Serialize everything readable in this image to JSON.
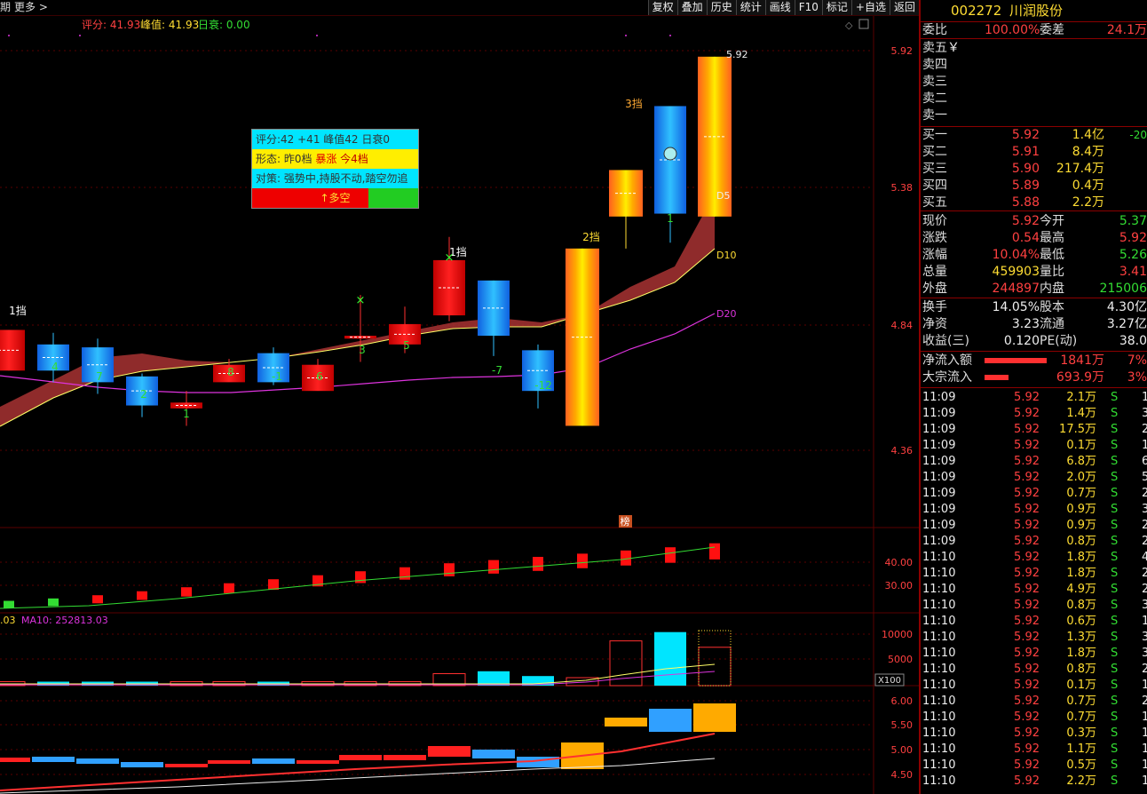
{
  "topbar": {
    "left_label": "期",
    "more": "更多 >",
    "buttons": [
      "复权",
      "叠加",
      "历史",
      "统计",
      "画线",
      "F10",
      "标记",
      "+自选",
      "返回"
    ]
  },
  "indicator_line": {
    "score_label": "评分: 41.93",
    "peak_label": "峰值: 41.93",
    "decay_label": "日衰: 0.00"
  },
  "info_box": {
    "row1": "评分:42  +41   峰值42  日衰0",
    "row2_prefix": "形态: 昨0档  ",
    "row2_highlight": "暴涨",
    "row2_suffix": " 今4档",
    "row3": "对策: 强势中,持股不动,踏空勿追",
    "row4": "↑多空"
  },
  "main_axis": [
    "5.92",
    "5.38",
    "4.84",
    "4.36"
  ],
  "ma_labels": {
    "d5": "D5",
    "d10": "D10",
    "d20": "D20",
    "top_price": "5.92"
  },
  "candle_labels": {
    "above": [
      "1挡",
      "1挡",
      "2挡",
      "3挡"
    ],
    "below": [
      "4",
      "7",
      "2",
      "1",
      "8",
      "-1",
      "6",
      "3",
      "5",
      "-7",
      "-12",
      "1"
    ]
  },
  "bang_label": "榜",
  "panel2_axis": [
    "40.00",
    "30.00"
  ],
  "panel3": {
    "ma_prefix": ".03",
    "ma10_label": "MA10: 252813.03",
    "axis": [
      "10000",
      "5000"
    ],
    "x100": "X100"
  },
  "panel4_axis": [
    "6.00",
    "5.50",
    "5.00",
    "4.50"
  ],
  "stock": {
    "code": "002272",
    "name": "川润股份"
  },
  "order_book": {
    "weibi_label": "委比",
    "weibi_value": "100.00%",
    "weicha_label": "委差",
    "weicha_value": "24.1万",
    "sell": [
      {
        "label": "卖五",
        "extra": "￥"
      },
      {
        "label": "卖四",
        "extra": ""
      },
      {
        "label": "卖三",
        "extra": ""
      },
      {
        "label": "卖二",
        "extra": ""
      },
      {
        "label": "卖一",
        "extra": ""
      }
    ],
    "buy": [
      {
        "label": "买一",
        "price": "5.92",
        "vol": "1.4亿",
        "chg": "-20"
      },
      {
        "label": "买二",
        "price": "5.91",
        "vol": "8.4万",
        "chg": ""
      },
      {
        "label": "买三",
        "price": "5.90",
        "vol": "217.4万",
        "chg": ""
      },
      {
        "label": "买四",
        "price": "5.89",
        "vol": "0.4万",
        "chg": ""
      },
      {
        "label": "买五",
        "price": "5.88",
        "vol": "2.2万",
        "chg": ""
      }
    ]
  },
  "quote": [
    {
      "l1": "现价",
      "v1": "5.92",
      "c1": "red",
      "l2": "今开",
      "v2": "5.37",
      "c2": "green"
    },
    {
      "l1": "涨跌",
      "v1": "0.54",
      "c1": "red",
      "l2": "最高",
      "v2": "5.92",
      "c2": "red"
    },
    {
      "l1": "涨幅",
      "v1": "10.04%",
      "c1": "red",
      "l2": "最低",
      "v2": "5.26",
      "c2": "green"
    },
    {
      "l1": "总量",
      "v1": "459903",
      "c1": "yellow",
      "l2": "量比",
      "v2": "3.41",
      "c2": "red"
    },
    {
      "l1": "外盘",
      "v1": "244897",
      "c1": "red",
      "l2": "内盘",
      "v2": "215006",
      "c2": "green"
    }
  ],
  "quote2": [
    {
      "l1": "换手",
      "v1": "14.05%",
      "l2": "股本",
      "v2": "4.30亿"
    },
    {
      "l1": "净资",
      "v1": "3.23",
      "l2": "流通",
      "v2": "3.27亿"
    },
    {
      "l1": "收益(三)",
      "v1": "0.120",
      "l2": "PE(动)",
      "v2": "38.0"
    }
  ],
  "flows": [
    {
      "label": "净流入额",
      "value": "1841万",
      "pct": "7%",
      "bar": 0.7
    },
    {
      "label": "大宗流入",
      "value": "693.9万",
      "pct": "3%",
      "bar": 0.27
    }
  ],
  "ticks": [
    {
      "t": "11:09",
      "p": "5.92",
      "v": "2.1万",
      "s": "S",
      "n": "1"
    },
    {
      "t": "11:09",
      "p": "5.92",
      "v": "1.4万",
      "s": "S",
      "n": "3"
    },
    {
      "t": "11:09",
      "p": "5.92",
      "v": "17.5万",
      "s": "S",
      "n": "2"
    },
    {
      "t": "11:09",
      "p": "5.92",
      "v": "0.1万",
      "s": "S",
      "n": "1"
    },
    {
      "t": "11:09",
      "p": "5.92",
      "v": "6.8万",
      "s": "S",
      "n": "6"
    },
    {
      "t": "11:09",
      "p": "5.92",
      "v": "2.0万",
      "s": "S",
      "n": "5"
    },
    {
      "t": "11:09",
      "p": "5.92",
      "v": "0.7万",
      "s": "S",
      "n": "2"
    },
    {
      "t": "11:09",
      "p": "5.92",
      "v": "0.9万",
      "s": "S",
      "n": "3"
    },
    {
      "t": "11:09",
      "p": "5.92",
      "v": "0.9万",
      "s": "S",
      "n": "2"
    },
    {
      "t": "11:09",
      "p": "5.92",
      "v": "0.8万",
      "s": "S",
      "n": "2"
    },
    {
      "t": "11:10",
      "p": "5.92",
      "v": "1.8万",
      "s": "S",
      "n": "4"
    },
    {
      "t": "11:10",
      "p": "5.92",
      "v": "1.8万",
      "s": "S",
      "n": "2"
    },
    {
      "t": "11:10",
      "p": "5.92",
      "v": "4.9万",
      "s": "S",
      "n": "2"
    },
    {
      "t": "11:10",
      "p": "5.92",
      "v": "0.8万",
      "s": "S",
      "n": "3"
    },
    {
      "t": "11:10",
      "p": "5.92",
      "v": "0.6万",
      "s": "S",
      "n": "1"
    },
    {
      "t": "11:10",
      "p": "5.92",
      "v": "1.3万",
      "s": "S",
      "n": "3"
    },
    {
      "t": "11:10",
      "p": "5.92",
      "v": "1.8万",
      "s": "S",
      "n": "3"
    },
    {
      "t": "11:10",
      "p": "5.92",
      "v": "0.8万",
      "s": "S",
      "n": "2"
    },
    {
      "t": "11:10",
      "p": "5.92",
      "v": "0.1万",
      "s": "S",
      "n": "1"
    },
    {
      "t": "11:10",
      "p": "5.92",
      "v": "0.7万",
      "s": "S",
      "n": "2"
    },
    {
      "t": "11:10",
      "p": "5.92",
      "v": "0.7万",
      "s": "S",
      "n": "1"
    },
    {
      "t": "11:10",
      "p": "5.92",
      "v": "0.3万",
      "s": "S",
      "n": "1"
    },
    {
      "t": "11:10",
      "p": "5.92",
      "v": "1.1万",
      "s": "S",
      "n": "1"
    },
    {
      "t": "11:10",
      "p": "5.92",
      "v": "0.5万",
      "s": "S",
      "n": "1"
    },
    {
      "t": "11:10",
      "p": "5.92",
      "v": "2.2万",
      "s": "S",
      "n": "1"
    }
  ],
  "candles": [
    {
      "o": 4.98,
      "h": 4.98,
      "l": 4.84,
      "c": 4.84,
      "kind": "red"
    },
    {
      "o": 4.84,
      "h": 4.97,
      "l": 4.8,
      "c": 4.93,
      "kind": "blue"
    },
    {
      "o": 4.8,
      "h": 4.95,
      "l": 4.76,
      "c": 4.92,
      "kind": "blue"
    },
    {
      "o": 4.72,
      "h": 4.83,
      "l": 4.68,
      "c": 4.82,
      "kind": "blue"
    },
    {
      "o": 4.73,
      "h": 4.77,
      "l": 4.65,
      "c": 4.71,
      "kind": "red"
    },
    {
      "o": 4.86,
      "h": 4.88,
      "l": 4.82,
      "c": 4.8,
      "kind": "red"
    },
    {
      "o": 4.8,
      "h": 4.92,
      "l": 4.79,
      "c": 4.9,
      "kind": "blue"
    },
    {
      "o": 4.86,
      "h": 4.88,
      "l": 4.78,
      "c": 4.77,
      "kind": "red"
    },
    {
      "o": 4.96,
      "h": 5.1,
      "l": 4.87,
      "c": 4.95,
      "kind": "red"
    },
    {
      "o": 5.0,
      "h": 5.06,
      "l": 4.9,
      "c": 4.93,
      "kind": "red"
    },
    {
      "o": 5.22,
      "h": 5.3,
      "l": 5.01,
      "c": 5.03,
      "kind": "red"
    },
    {
      "o": 4.96,
      "h": 5.15,
      "l": 4.89,
      "c": 5.15,
      "kind": "blue"
    },
    {
      "o": 4.77,
      "h": 4.93,
      "l": 4.71,
      "c": 4.91,
      "kind": "blue"
    },
    {
      "o": 5.26,
      "h": 5.26,
      "l": 4.65,
      "c": 4.65,
      "kind": "gold"
    },
    {
      "o": 5.53,
      "h": 5.53,
      "l": 5.26,
      "c": 5.37,
      "kind": "gold"
    },
    {
      "o": 5.38,
      "h": 5.75,
      "l": 5.28,
      "c": 5.75,
      "kind": "blue"
    },
    {
      "o": 5.92,
      "h": 5.92,
      "l": 5.37,
      "c": 5.37,
      "kind": "gold"
    }
  ],
  "volumes": [
    0.05,
    0.05,
    0.05,
    0.05,
    0.05,
    0.05,
    0.05,
    0.05,
    0.05,
    0.05,
    0.15,
    0.18,
    0.12,
    0.1,
    0.56,
    0.67,
    0.48
  ],
  "macd_tops": [
    0.15,
    0.18,
    0.22,
    0.27,
    0.32,
    0.37,
    0.42,
    0.47,
    0.52,
    0.57,
    0.62,
    0.66,
    0.7,
    0.74,
    0.78,
    0.82,
    0.87
  ]
}
